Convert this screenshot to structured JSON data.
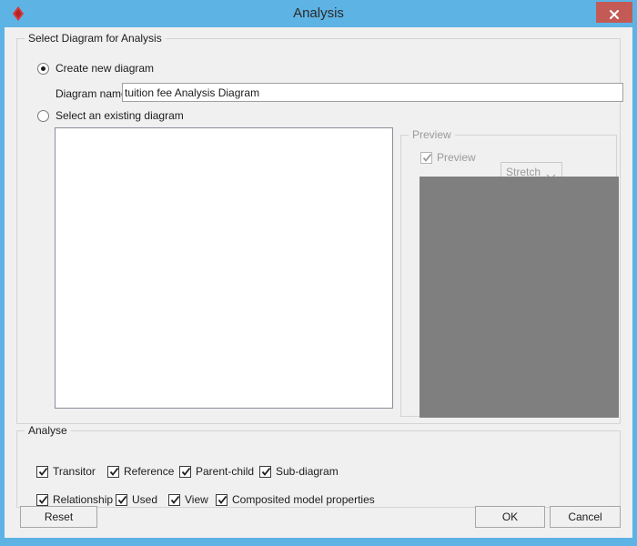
{
  "window": {
    "title": "Analysis",
    "app_icon": "diamond-icon",
    "close_label": "×",
    "titlebar_color": "#5db3e4",
    "close_button_color": "#c45a55",
    "client_background": "#f0f0f0"
  },
  "select_group": {
    "title": "Select Diagram for Analysis",
    "radio_create": {
      "label": "Create new diagram",
      "checked": true
    },
    "radio_existing": {
      "label": "Select an existing diagram",
      "checked": false
    },
    "diagram_name": {
      "label": "Diagram name:",
      "value": "tuition fee Analysis Diagram",
      "placeholder": ""
    },
    "list_items": []
  },
  "preview_group": {
    "title": "Preview",
    "enabled": false,
    "checkbox": {
      "label": "Preview",
      "checked": true
    },
    "mode_select": {
      "value": "Stretch",
      "options": [
        "Stretch"
      ]
    },
    "preview_color": "#7f7f7f"
  },
  "analyse_group": {
    "title": "Analyse",
    "row1": [
      {
        "label": "Transitor",
        "checked": true
      },
      {
        "label": "Reference",
        "checked": true
      },
      {
        "label": "Parent-child",
        "checked": true
      },
      {
        "label": "Sub-diagram",
        "checked": true
      }
    ],
    "row2": [
      {
        "label": "Relationship",
        "checked": true
      },
      {
        "label": "Used",
        "checked": true
      },
      {
        "label": "View",
        "checked": true
      },
      {
        "label": "Composited model properties",
        "checked": true
      }
    ]
  },
  "buttons": {
    "reset": "Reset",
    "ok": "OK",
    "cancel": "Cancel"
  }
}
